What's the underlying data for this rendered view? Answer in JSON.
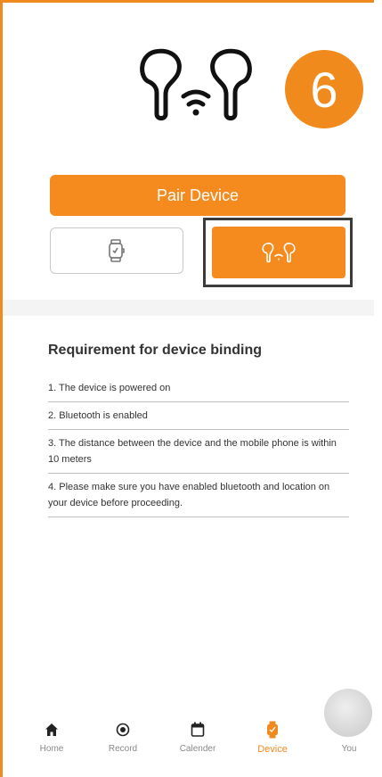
{
  "header": {
    "step_number": "6"
  },
  "pair_button": {
    "label": "Pair Device"
  },
  "device_types": [
    {
      "name": "watch",
      "icon": "watch-icon",
      "selected": false
    },
    {
      "name": "earbuds",
      "icon": "earbuds-icon",
      "selected": true
    }
  ],
  "requirements": {
    "title": "Requirement for device binding",
    "items": [
      "1. The device is powered on",
      "2. Bluetooth is enabled",
      "3. The distance between the device and the mobile phone is within 10 meters",
      "4. Please make sure you have enabled bluetooth and location on your device before proceeding."
    ]
  },
  "tabbar": {
    "tabs": [
      {
        "label": "Home",
        "icon": "home-icon"
      },
      {
        "label": "Record",
        "icon": "record-icon"
      },
      {
        "label": "Calender",
        "icon": "calendar-icon"
      },
      {
        "label": "Device",
        "icon": "device-icon",
        "active": true
      },
      {
        "label": "You",
        "icon": "avatar"
      }
    ]
  },
  "colors": {
    "accent": "#f58b1f",
    "badge": "#f18a1c",
    "text": "#333333",
    "muted": "#888888"
  }
}
